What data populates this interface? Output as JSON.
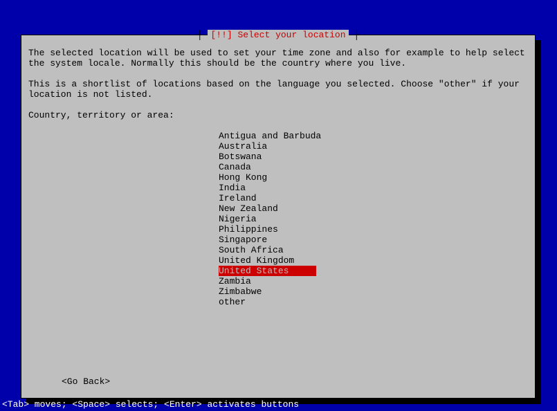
{
  "dialog": {
    "title": "[!!] Select your location",
    "paragraph1": "The selected location will be used to set your time zone and also for example to help select the system locale. Normally this should be the country where you live.",
    "paragraph2": "This is a shortlist of locations based on the language you selected. Choose \"other\" if your location is not listed.",
    "prompt": "Country, territory or area:",
    "items": [
      "Antigua and Barbuda",
      "Australia",
      "Botswana",
      "Canada",
      "Hong Kong",
      "India",
      "Ireland",
      "New Zealand",
      "Nigeria",
      "Philippines",
      "Singapore",
      "South Africa",
      "United Kingdom",
      "United States",
      "Zambia",
      "Zimbabwe",
      "other"
    ],
    "selectedIndex": 13,
    "goBack": "<Go Back>"
  },
  "footer": "<Tab> moves; <Space> selects; <Enter> activates buttons"
}
